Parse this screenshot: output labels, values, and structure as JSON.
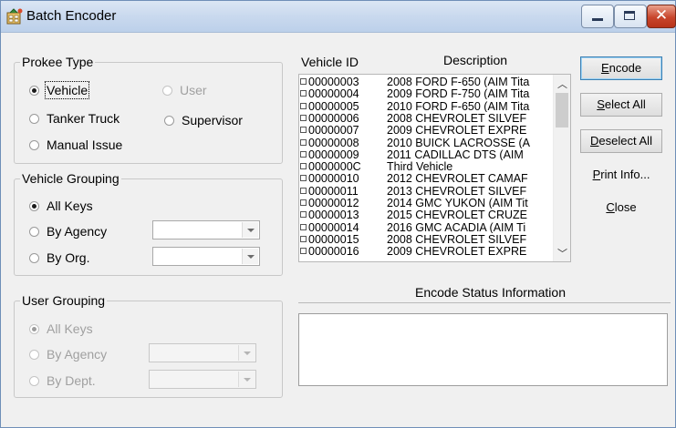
{
  "window": {
    "title": "Batch Encoder"
  },
  "prokee_type": {
    "legend": "Prokee Type",
    "options": [
      {
        "label": "Vehicle",
        "selected": true,
        "enabled": true
      },
      {
        "label": "User",
        "selected": false,
        "enabled": false
      },
      {
        "label": "Tanker Truck",
        "selected": false,
        "enabled": true
      },
      {
        "label": "Supervisor",
        "selected": false,
        "enabled": true
      },
      {
        "label": "Manual Issue",
        "selected": false,
        "enabled": true
      }
    ]
  },
  "vehicle_grouping": {
    "legend": "Vehicle Grouping",
    "options": [
      {
        "label": "All Keys",
        "selected": true,
        "enabled": true
      },
      {
        "label": "By Agency",
        "selected": false,
        "enabled": true,
        "combo_value": ""
      },
      {
        "label": "By Org.",
        "selected": false,
        "enabled": true,
        "combo_value": ""
      }
    ]
  },
  "user_grouping": {
    "legend": "User Grouping",
    "options": [
      {
        "label": "All Keys",
        "selected": true,
        "enabled": false
      },
      {
        "label": "By Agency",
        "selected": false,
        "enabled": false,
        "combo_value": ""
      },
      {
        "label": "By Dept.",
        "selected": false,
        "enabled": false,
        "combo_value": ""
      }
    ]
  },
  "vehicle_list": {
    "col_id": "Vehicle ID",
    "col_desc": "Description",
    "rows": [
      {
        "id": "00000003",
        "desc": "2008 FORD F-650 (AIM Tita"
      },
      {
        "id": "00000004",
        "desc": "2009 FORD F-750 (AIM Tita"
      },
      {
        "id": "00000005",
        "desc": "2010 FORD F-650 (AIM Tita"
      },
      {
        "id": "00000006",
        "desc": "2008 CHEVROLET SILVEF"
      },
      {
        "id": "00000007",
        "desc": "2009 CHEVROLET EXPRE"
      },
      {
        "id": "00000008",
        "desc": "2010 BUICK LACROSSE (A"
      },
      {
        "id": "00000009",
        "desc": "2011 CADILLAC DTS (AIM"
      },
      {
        "id": "0000000C",
        "desc": "Third Vehicle"
      },
      {
        "id": "00000010",
        "desc": "2012 CHEVROLET CAMAF"
      },
      {
        "id": "00000011",
        "desc": "2013 CHEVROLET SILVEF"
      },
      {
        "id": "00000012",
        "desc": "2014 GMC YUKON (AIM Tit"
      },
      {
        "id": "00000013",
        "desc": "2015 CHEVROLET CRUZE"
      },
      {
        "id": "00000014",
        "desc": "2016 GMC ACADIA (AIM Ti"
      },
      {
        "id": "00000015",
        "desc": "2008 CHEVROLET SILVEF"
      },
      {
        "id": "00000016",
        "desc": "2009 CHEVROLET EXPRE"
      }
    ]
  },
  "status": {
    "label": "Encode Status Information",
    "text": ""
  },
  "buttons": {
    "encode": "Encode",
    "select_all": "Select All",
    "deselect_all": "Deselect All",
    "print_info": "Print Info...",
    "close": "Close"
  },
  "icons": {
    "app": "batch-encoder-icon",
    "minimize": "minimize-icon",
    "maximize": "maximize-icon",
    "close": "close-icon"
  }
}
